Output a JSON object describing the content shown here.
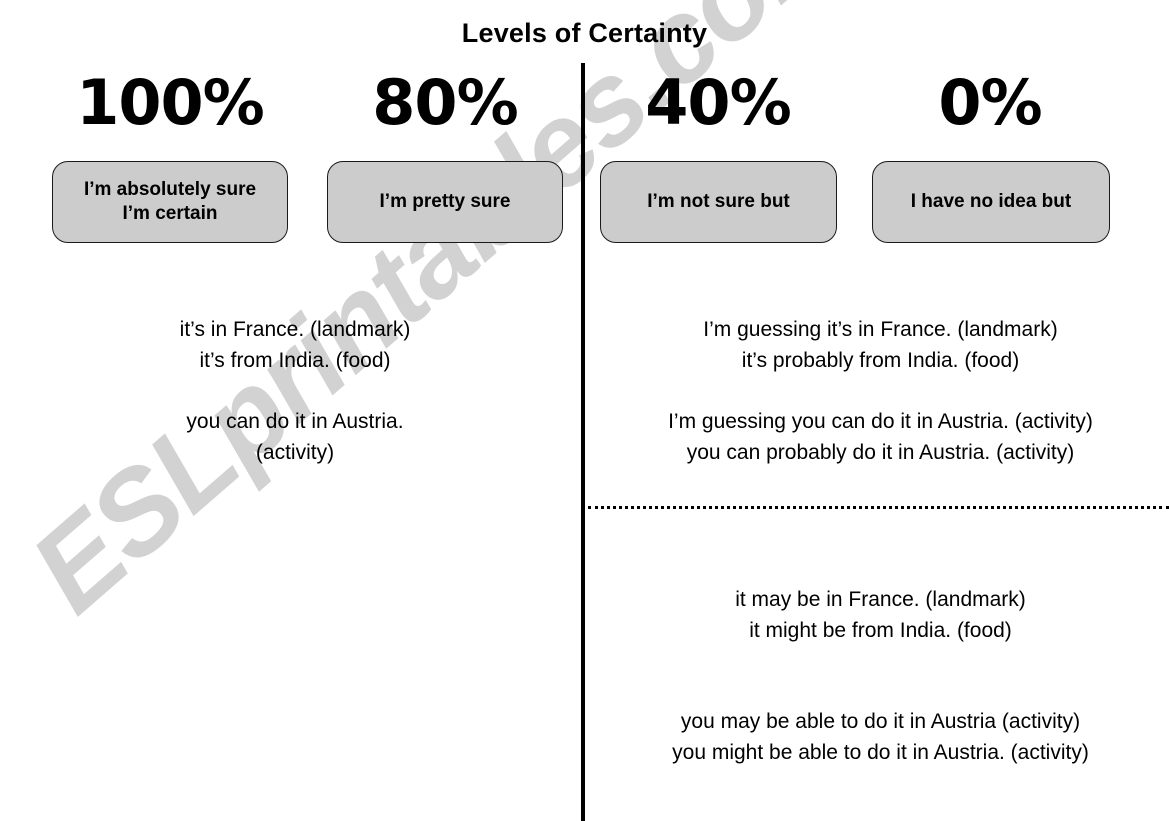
{
  "page": {
    "title": "Levels of Certainty",
    "watermark": "ESLprintables.com"
  },
  "columns": [
    {
      "percent": "100%",
      "phrase": "I’m absolutely sure\nI’m certain"
    },
    {
      "percent": "80%",
      "phrase": "I’m pretty sure"
    },
    {
      "percent": "40%",
      "phrase": "I’m not sure but"
    },
    {
      "percent": "0%",
      "phrase": "I have no idea but"
    }
  ],
  "left_panel": {
    "block_a": "it’s in France. (landmark)\nit’s from India. (food)",
    "block_b": "you can do it in Austria.\n(activity)"
  },
  "right_panel": {
    "block_a": "I’m guessing it’s in France. (landmark)\nit’s probably from India. (food)",
    "block_b": "I’m guessing you can do it in Austria. (activity)\nyou can probably do it in Austria. (activity)",
    "block_c": "it may be in France. (landmark)\nit might be from India. (food)",
    "block_d": "you may be able to do it in Austria (activity)\nyou might be able to do it in Austria. (activity)"
  },
  "colors": {
    "box_fill": "#cccccc",
    "box_border": "#1a1a1a",
    "text": "#000000",
    "watermark": "#d2d2d2",
    "background": "#ffffff"
  }
}
